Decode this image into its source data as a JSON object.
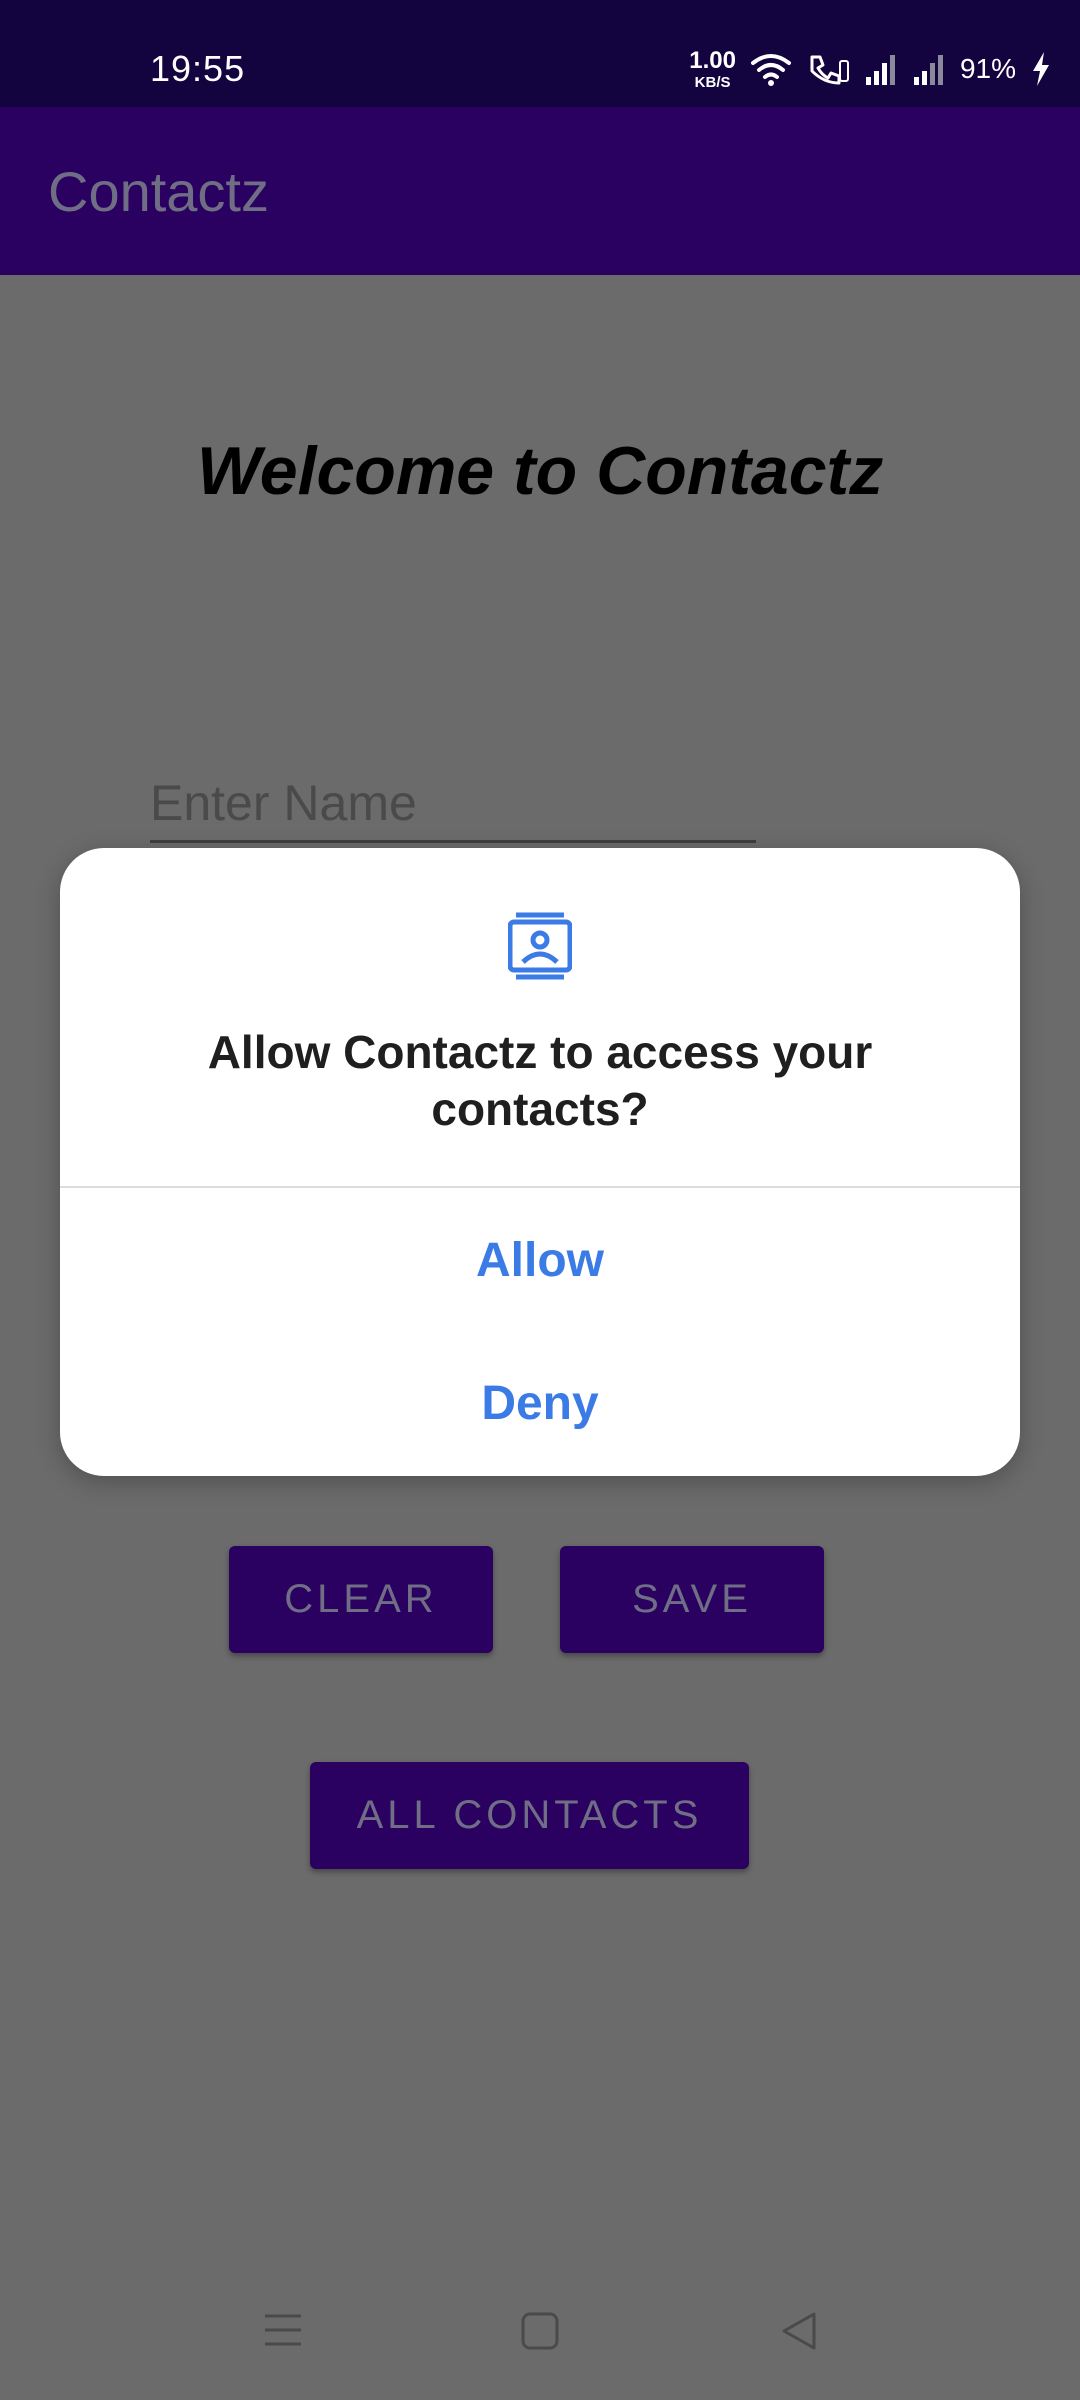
{
  "status_bar": {
    "time": "19:55",
    "net_speed_value": "1.00",
    "net_speed_unit": "KB/S",
    "battery": "91%"
  },
  "app_bar": {
    "title": "Contactz"
  },
  "main": {
    "welcome": "Welcome to Contactz",
    "name_placeholder": "Enter Name",
    "clear_label": "CLEAR",
    "save_label": "SAVE",
    "all_contacts_label": "ALL CONTACTS"
  },
  "dialog": {
    "icon": "contacts-icon",
    "message": "Allow Contactz to access your contacts?",
    "allow_label": "Allow",
    "deny_label": "Deny"
  },
  "colors": {
    "status_bar": "#13033f",
    "app_bar": "#2a0061",
    "scrim_background": "#6b6b6b",
    "dialog_accent": "#3b7be6"
  }
}
